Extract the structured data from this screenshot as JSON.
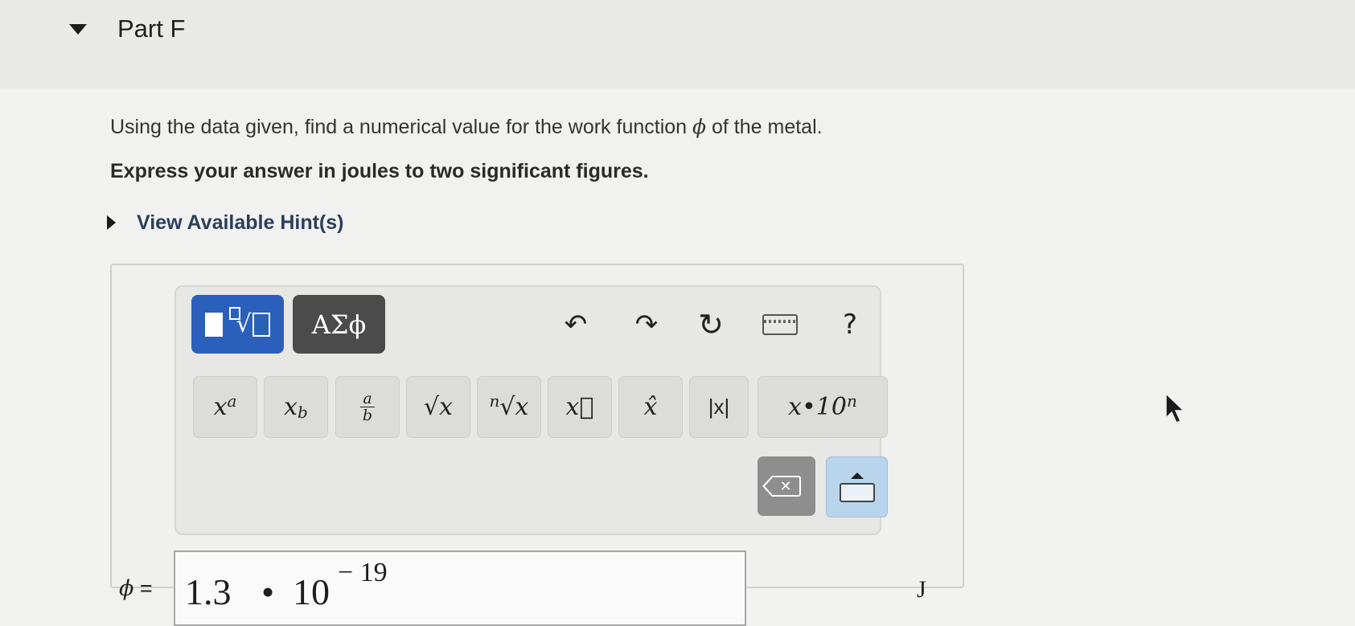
{
  "part": {
    "title": "Part F"
  },
  "question": {
    "text_before": "Using the data given, find a numerical value for the work function ",
    "symbol": "ϕ",
    "text_after": " of the metal.",
    "instruction": "Express your answer in joules to two significant figures."
  },
  "hints": {
    "label": "View Available Hint(s)"
  },
  "toolbar": {
    "greek_label": "ΑΣϕ",
    "undo_glyph": "↶",
    "redo_glyph": "↷",
    "reset_glyph": "↻",
    "help_label": "?"
  },
  "keypad": {
    "keys": [
      {
        "base": "x",
        "sup": "a"
      },
      {
        "base": "x",
        "sub": "b"
      },
      {
        "num": "a",
        "den": "b"
      },
      {
        "label": "√x"
      },
      {
        "index": "n",
        "label": "√x"
      },
      {
        "label": "x⃗"
      },
      {
        "label": "x̂"
      },
      {
        "label": "|x|"
      },
      {
        "label": "x•10",
        "sup": "n"
      }
    ],
    "backspace_glyph": "✕"
  },
  "answer": {
    "label_symbol": "ϕ",
    "label_eq": " =",
    "mantissa": "1.3",
    "times": "•",
    "base": "10",
    "exponent": "− 19",
    "unit": "J"
  }
}
